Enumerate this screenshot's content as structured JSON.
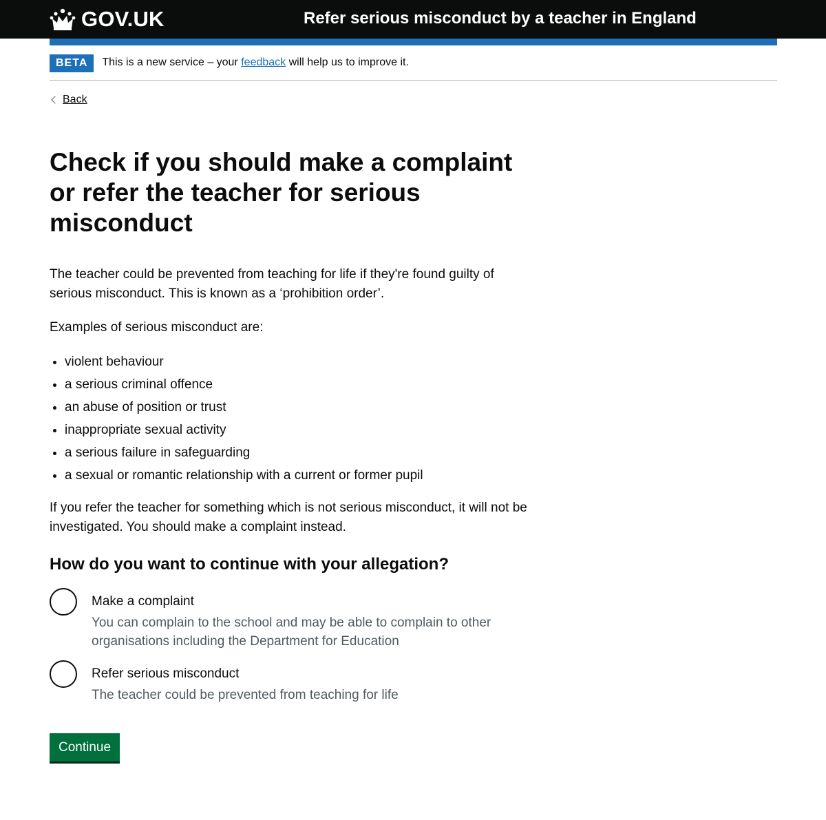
{
  "header": {
    "logo_text": "GOV.UK",
    "service_name": "Refer serious misconduct by a teacher in England",
    "background": "#0b0c0c",
    "accent": "#1d70b8"
  },
  "phase_banner": {
    "tag": "BETA",
    "text_before": "This is a new service – your ",
    "link": "feedback",
    "text_after": " will help us to improve it."
  },
  "back_link": "Back",
  "page": {
    "title": "Check if you should make a complaint or refer the teacher for serious misconduct",
    "intro": "The teacher could be prevented from teaching for life if they're found guilty of serious misconduct. This is known as a ‘prohibition order’.",
    "examples_intro": "Examples of serious misconduct are:",
    "examples": [
      "violent behaviour",
      "a serious criminal offence",
      "an abuse of position or trust",
      "inappropriate sexual activity",
      "a serious failure in safeguarding",
      "a sexual or romantic relationship with a current or former pupil"
    ],
    "warning": "If you refer the teacher for something which is not serious misconduct, it will not be investigated. You should make a complaint instead."
  },
  "question": {
    "legend": "How do you want to continue with your allegation?",
    "options": [
      {
        "label": "Make a complaint",
        "hint": "You can complain to the school and may be able to complain to other organisations including the Department for Education"
      },
      {
        "label": "Refer serious misconduct",
        "hint": "The teacher could be prevented from teaching for life"
      }
    ]
  },
  "continue_label": "Continue",
  "colors": {
    "link": "#1d70b8",
    "button": "#00703c",
    "hint": "#505a5f"
  }
}
